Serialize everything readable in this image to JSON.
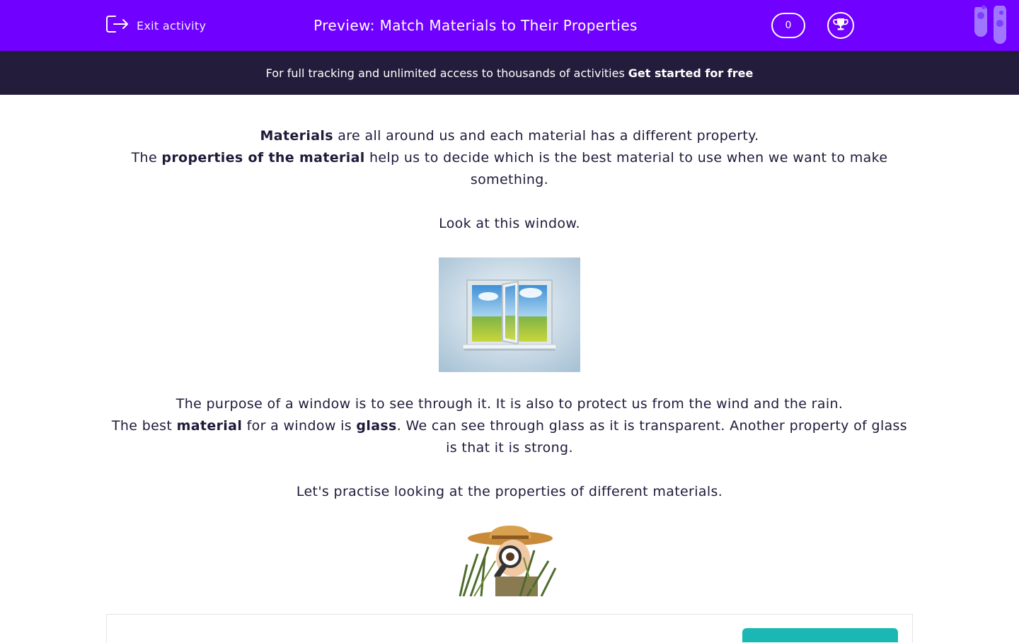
{
  "header": {
    "exit_label": "Exit activity",
    "title": "Preview: Match Materials to Their Properties",
    "score": "0",
    "exit_icon": "exit-icon",
    "trophy_icon": "trophy-icon",
    "background_color": "#7000ff"
  },
  "banner": {
    "text": "For full tracking and unlimited access to thousands of activities",
    "cta": "Get started for free",
    "background_color": "#231c3b"
  },
  "content": {
    "intro": {
      "p1_bold": "Materials",
      "p1_rest": " are all around us and each material has a different property.",
      "p2_start": "The ",
      "p2_bold": "properties of the material",
      "p2_rest": " help us to decide which is the best material to use when we want to make something."
    },
    "look": "Look at this window.",
    "purpose": {
      "line1": "The purpose of a window is to see through it.  It is also to protect us from the wind and the rain.",
      "l2_a": "The best ",
      "l2_bold1": "material",
      "l2_b": " for a window is ",
      "l2_bold2": "glass",
      "l2_c": ".  We can see through glass as it is transparent. Another property of glass is that it is strong."
    },
    "practise": "Let's practise looking at the properties of different materials."
  },
  "colors": {
    "accent": "#7000ff",
    "text": "#1f1a3a",
    "button": "#1ab7b5"
  }
}
